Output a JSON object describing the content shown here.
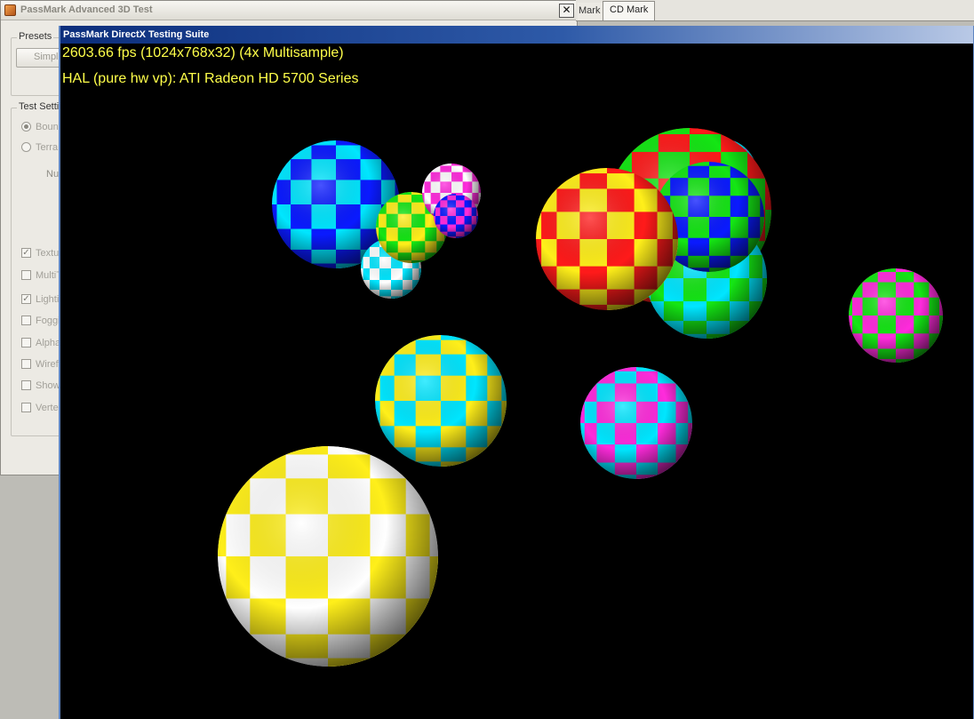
{
  "background_window": {
    "title": "PassMark Advanced 3D Test",
    "close_glyph": "✕",
    "presets_label": "Presets",
    "simple_button": "Simple",
    "test_settings_label": "Test Setti",
    "radios": [
      {
        "label": "Boun",
        "selected": true
      },
      {
        "label": "Terra",
        "selected": false
      }
    ],
    "number_label": "Nu",
    "checkboxes": [
      {
        "label": "Textu",
        "checked": true
      },
      {
        "label": "MultiT",
        "checked": false
      },
      {
        "label": "Lighti",
        "checked": true
      },
      {
        "label": "Foggi",
        "checked": false
      },
      {
        "label": "Alpha",
        "checked": false
      },
      {
        "label": "Wiref",
        "checked": false
      },
      {
        "label": "Show",
        "checked": false
      },
      {
        "label": "Verte",
        "checked": false
      }
    ]
  },
  "tabs": [
    {
      "label": "Mark",
      "active": false
    },
    {
      "label": "CD Mark",
      "active": true
    }
  ],
  "dx_window": {
    "title": "PassMark DirectX Testing Suite",
    "fps_text": "2603.66 fps (1024x768x32) (4x Multisample)",
    "hal_text": "HAL (pure hw vp): ATI Radeon HD 5700 Series"
  },
  "colors": {
    "hud_text": "#ffff4a",
    "title_active_start": "#0c2e7c",
    "viewport_bg": "#000000"
  },
  "scene": {
    "description_icon": "checkered-ball-icon",
    "ball_palettes": [
      [
        "#ffffff",
        "#ffef1a"
      ],
      [
        "#00e6ff",
        "#ffef1a"
      ],
      [
        "#00e6ff",
        "#ff2bdc"
      ],
      [
        "#ff1a1a",
        "#ffef1a"
      ],
      [
        "#00e6ff",
        "#14e614"
      ],
      [
        "#0a1aff",
        "#14e614"
      ],
      [
        "#ff1a1a",
        "#14e614"
      ],
      [
        "#ff2bdc",
        "#ffffff"
      ],
      [
        "#0a1aff",
        "#00e6ff"
      ],
      [
        "#ffffff",
        "#00e6ff"
      ],
      [
        "#ffef1a",
        "#14e614"
      ],
      [
        "#ff2bdc",
        "#14e614"
      ],
      [
        "#ff2bdc",
        "#0a1aff"
      ]
    ]
  }
}
